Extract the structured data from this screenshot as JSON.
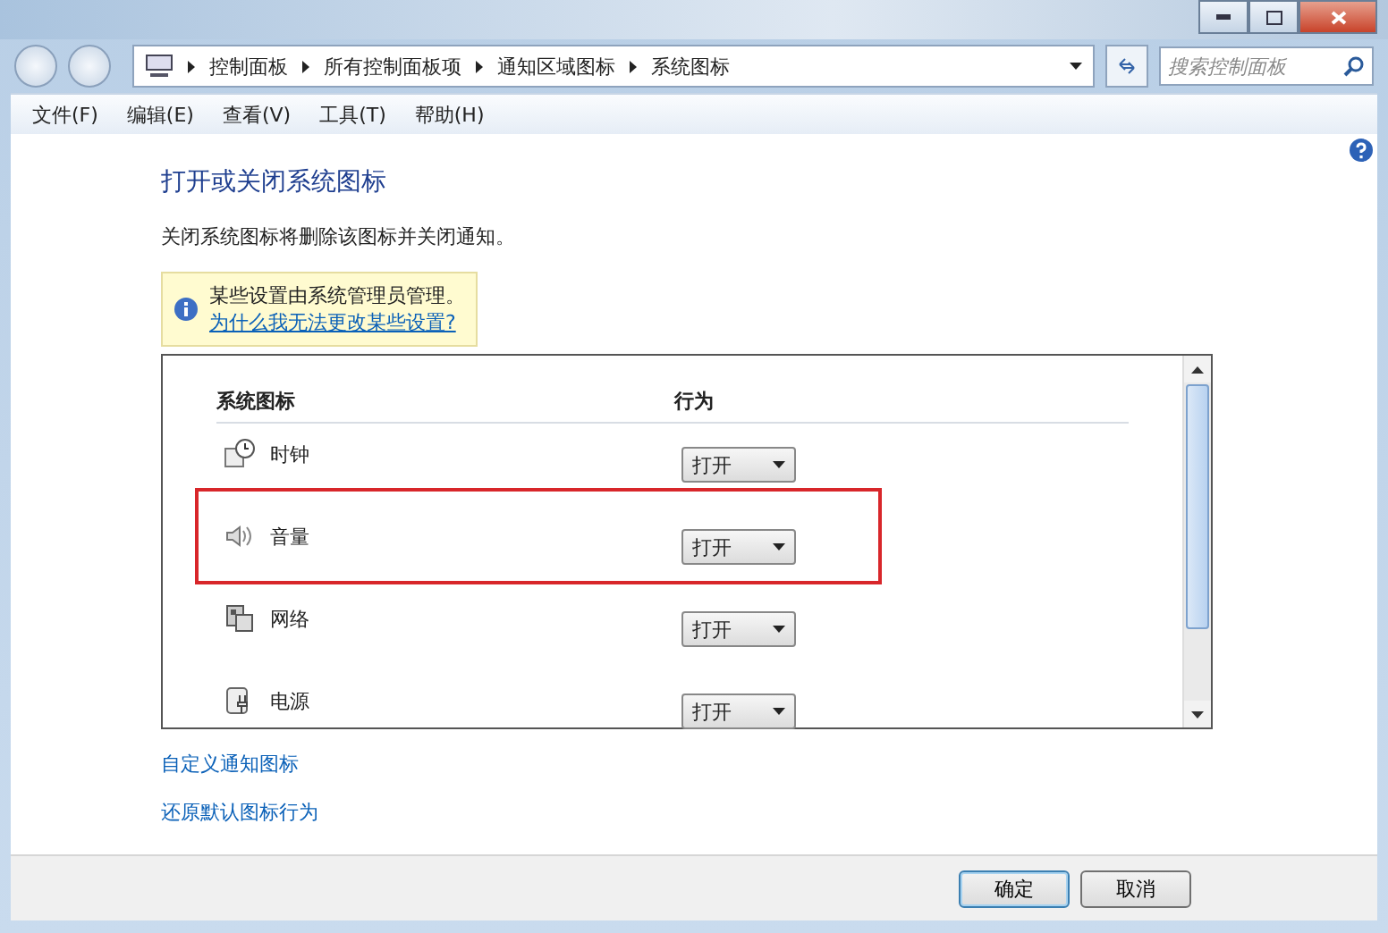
{
  "address_bar": {
    "breadcrumbs": [
      "控制面板",
      "所有控制面板项",
      "通知区域图标",
      "系统图标"
    ]
  },
  "search": {
    "placeholder": "搜索控制面板"
  },
  "menu": [
    "文件(F)",
    "编辑(E)",
    "查看(V)",
    "工具(T)",
    "帮助(H)"
  ],
  "page": {
    "title": "打开或关闭系统图标",
    "description": "关闭系统图标将删除该图标并关闭通知。",
    "notice": {
      "text": "某些设置由系统管理员管理。",
      "link": "为什么我无法更改某些设置?"
    }
  },
  "table": {
    "columns": [
      "系统图标",
      "行为"
    ],
    "rows": [
      {
        "kind": "clock",
        "name": "时钟",
        "behavior": "打开",
        "highlighted": false
      },
      {
        "kind": "volume",
        "name": "音量",
        "behavior": "打开",
        "highlighted": true
      },
      {
        "kind": "network",
        "name": "网络",
        "behavior": "打开",
        "highlighted": false
      },
      {
        "kind": "power",
        "name": "电源",
        "behavior": "打开",
        "highlighted": false
      }
    ]
  },
  "links": [
    "自定义通知图标",
    "还原默认图标行为"
  ],
  "buttons": [
    {
      "label": "确定",
      "default": true
    },
    {
      "label": "取消",
      "default": false
    }
  ]
}
